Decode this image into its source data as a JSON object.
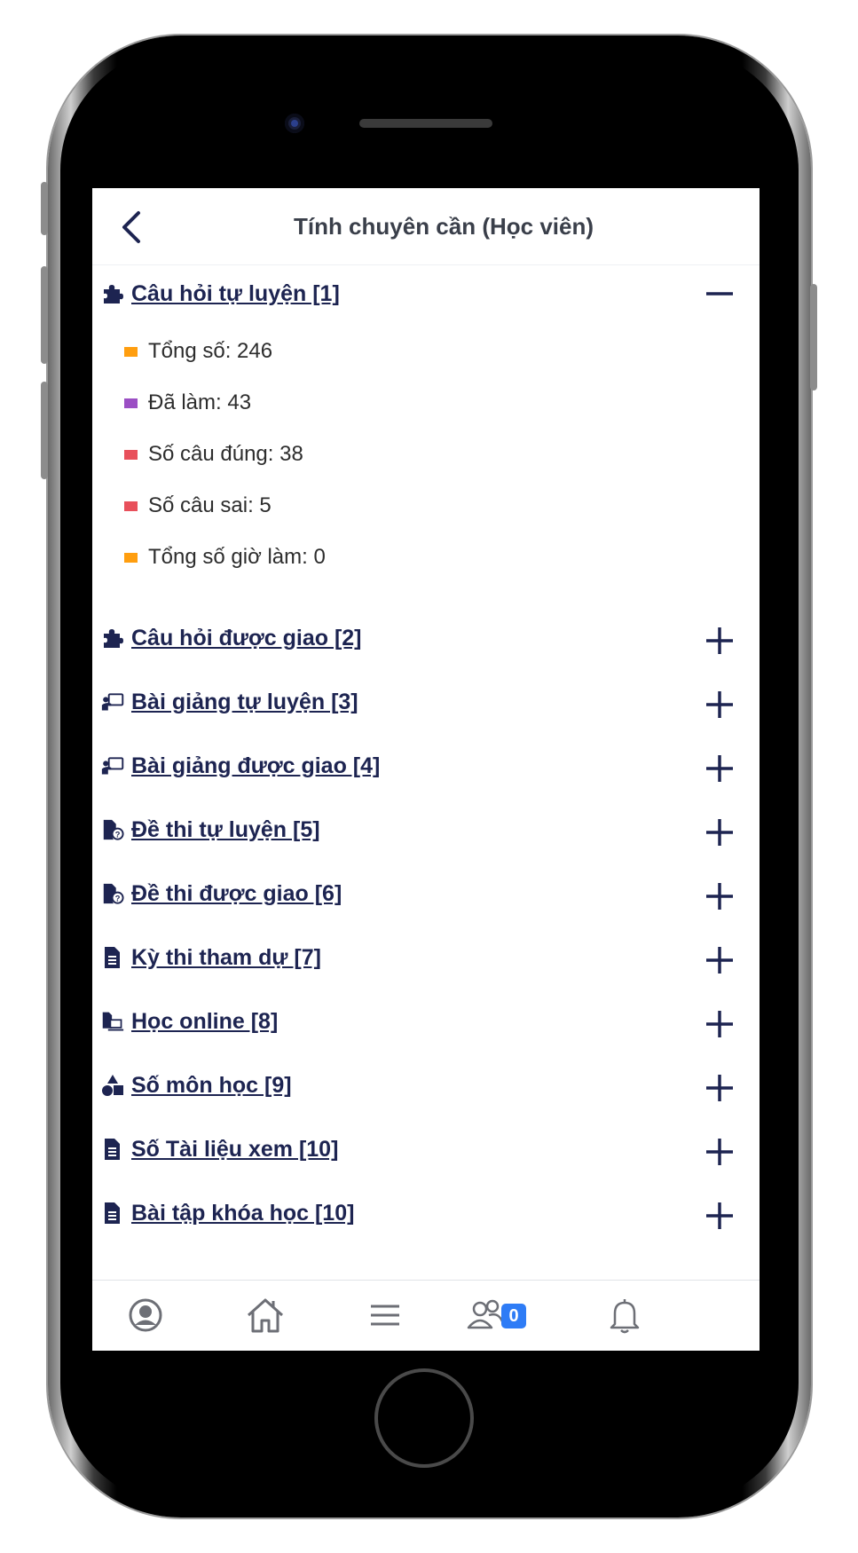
{
  "header": {
    "title": "Tính chuyên cần (Học viên)"
  },
  "sections": [
    {
      "title": "Câu hỏi tự luyện [1]",
      "icon": "puzzle-icon",
      "expanded": true
    },
    {
      "title": "Câu hỏi được giao [2]",
      "icon": "puzzle-icon",
      "expanded": false
    },
    {
      "title": "Bài giảng tự luyện [3]",
      "icon": "teacher-board-icon",
      "expanded": false
    },
    {
      "title": "Bài giảng được giao [4]",
      "icon": "teacher-board-icon",
      "expanded": false
    },
    {
      "title": "Đề thi tự luyện [5]",
      "icon": "exam-file-icon",
      "expanded": false
    },
    {
      "title": "Đề thi được giao [6]",
      "icon": "exam-file-icon",
      "expanded": false
    },
    {
      "title": "Kỳ thi tham dự [7]",
      "icon": "document-icon",
      "expanded": false
    },
    {
      "title": "Học online [8]",
      "icon": "online-learning-icon",
      "expanded": false
    },
    {
      "title": "Số môn học [9]",
      "icon": "shapes-icon",
      "expanded": false
    },
    {
      "title": "Số Tài liệu xem [10]",
      "icon": "document-icon",
      "expanded": false
    },
    {
      "title": "Bài tập khóa học [10]",
      "icon": "document-icon",
      "expanded": false
    }
  ],
  "stats": [
    {
      "label": "Tổng số: 246",
      "color": "#ff9e0f"
    },
    {
      "label": "Đã làm: 43",
      "color": "#9b4fc4"
    },
    {
      "label": "Số câu đúng: 38",
      "color": "#e8505b"
    },
    {
      "label": "Số câu sai: 5",
      "color": "#e8505b"
    },
    {
      "label": "Tổng số giờ làm: 0",
      "color": "#ff9e0f"
    }
  ],
  "bottom_nav": {
    "items": [
      "profile-icon",
      "home-icon",
      "menu-icon",
      "group-icon",
      "bell-icon"
    ],
    "group_badge": "0"
  },
  "colors": {
    "accent": "#1d2451",
    "badge": "#2e7cf6"
  }
}
